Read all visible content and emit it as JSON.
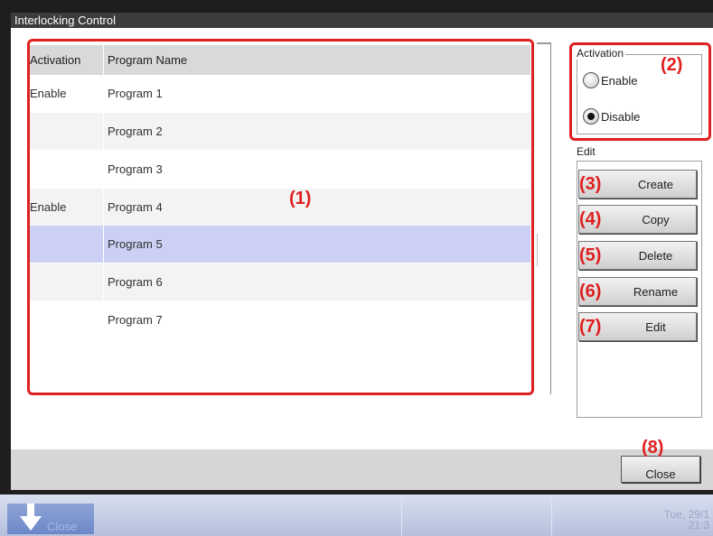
{
  "window": {
    "title": "Interlocking Control"
  },
  "program_list": {
    "columns": [
      "Activation",
      "Program Name"
    ],
    "rows": [
      {
        "activation": "Enable",
        "name": "Program 1"
      },
      {
        "activation": "",
        "name": "Program 2"
      },
      {
        "activation": "",
        "name": "Program 3"
      },
      {
        "activation": "Enable",
        "name": "Program 4"
      },
      {
        "activation": "",
        "name": "Program 5"
      },
      {
        "activation": "",
        "name": "Program 6"
      },
      {
        "activation": "",
        "name": "Program 7"
      }
    ],
    "selected_row": "Program 5"
  },
  "activation_group": {
    "legend": "Activation",
    "options": [
      "Enable",
      "Disable"
    ],
    "selected": "Disable"
  },
  "edit_group": {
    "legend": "Edit",
    "buttons": [
      "Create",
      "Copy",
      "Delete",
      "Rename",
      "Edit"
    ]
  },
  "close_button": {
    "label": "Close"
  },
  "callouts": [
    "(1)",
    "(2)",
    "(3)",
    "(4)",
    "(5)",
    "(6)",
    "(7)",
    "(8)"
  ],
  "taskbar": {
    "start_label": "Close",
    "date": "Tue, 29/1",
    "time": "21:3"
  },
  "colors": {
    "highlight": "#e02020",
    "selected_row": "#ccd0f5",
    "title_bar": "#3c3c3c"
  }
}
